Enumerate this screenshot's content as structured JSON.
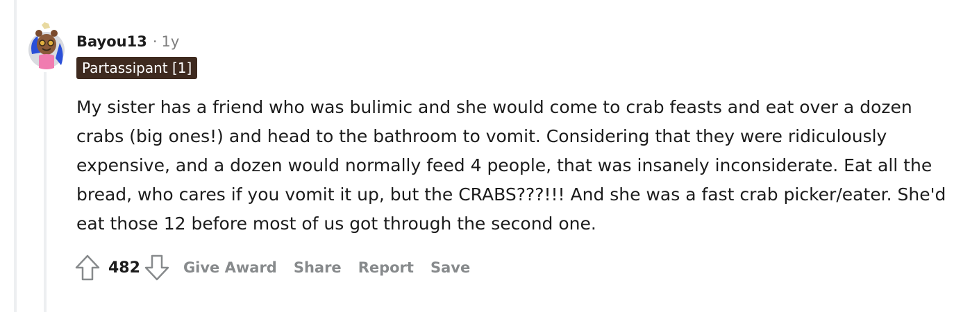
{
  "comment": {
    "author": "Bayou13",
    "separator": "·",
    "age": "1y",
    "flair": "Partassipant [1]",
    "avatar_icon": "user-avatar-icon",
    "body": "My sister has a friend who was bulimic and she would come to crab feasts and eat over a dozen crabs (big ones!) and head to the bathroom to vomit. Considering that they were ridiculously expensive, and a dozen would normally feed 4 people, that was insanely inconsiderate. Eat all the bread, who cares if you vomit it up, but the CRABS???!!! And she was a fast crab picker/eater. She'd eat those 12 before most of us got through the second one."
  },
  "actions": {
    "upvote_icon": "upvote-arrow-icon",
    "score": "482",
    "downvote_icon": "downvote-arrow-icon",
    "give_award": "Give Award",
    "share": "Share",
    "report": "Report",
    "save": "Save"
  },
  "colors": {
    "thread_line": "#edeff1",
    "flair_bg": "#3e2a1f",
    "action_text": "#878a8c",
    "meta_text": "#7c7c7c"
  }
}
